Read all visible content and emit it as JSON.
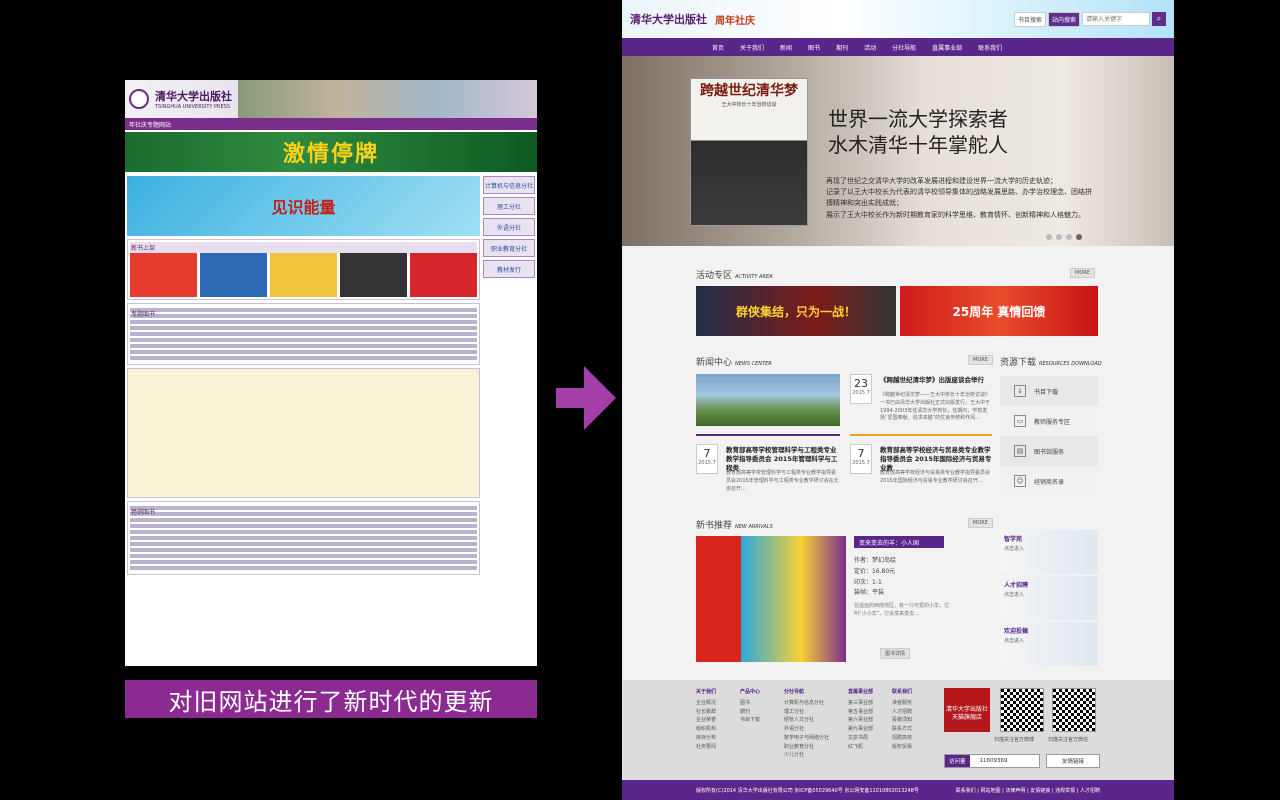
{
  "old_site": {
    "logo": "清华大学出版社",
    "logo_en": "TSINGHUA UNIVERSITY PRESS",
    "anniversary_strip": "年社庆专题网站",
    "banner_text": "激情停牌",
    "ad_text": "见识能量",
    "side_links": [
      "计算机与信息分社",
      "理工分社",
      "外语分社",
      "职业教育分社",
      "教材发行"
    ],
    "block_titles": [
      "新书上架",
      "专题图书",
      "畅销图书"
    ]
  },
  "caption": "对旧网站进行了新时代的更新",
  "arrow_color": "#a43ea8",
  "new_site": {
    "brand": "清华大学出版社",
    "anniversary": "周年社庆",
    "search": {
      "option1": "书目搜索",
      "option2": "站内搜索",
      "placeholder": "请输入关键字"
    },
    "nav": [
      "首页",
      "关于我们",
      "新闻",
      "图书",
      "期刊",
      "活动",
      "分社导航",
      "直属事业部",
      "联系我们"
    ],
    "hero": {
      "book_title": "跨越世纪清华梦",
      "book_subtitle": "王大中校长十年治校访谈",
      "headline1": "世界一流大学探索者",
      "headline2": "水木清华十年掌舵人",
      "summary1": "再现了世纪之交清华大学的改革发展进程和建设世界一流大学的历史轨迹；",
      "summary2": "记录了以王大中校长为代表的清华校领导集体的战略发展思路、办学治校理念、团结拼搏精神和突出实践成就；",
      "summary3": "展示了王大中校长作为新时期教育家的科学思维、教育情怀、创新精神和人格魅力。"
    },
    "activity": {
      "title": "活动专区",
      "title_en": "ACTIVITY AREA",
      "more": "MORE",
      "banner1": "群侠集结，只为一战！",
      "banner2": "25周年 真情回馈"
    },
    "news": {
      "title": "新闻中心",
      "title_en": "NEWS CENTER",
      "more": "MORE",
      "items": [
        {
          "day": "23",
          "ym": "2015.7",
          "title": "《跨越世纪清华梦》出版座谈会举行",
          "text": "《跨越世纪清华梦——王大中校长十年治校访谈》一书已由清华大学出版社正式出版发行。王大中于1994-2003年任清华大学校长，任期内，学校发扬“爱国奉献、追求卓越”的优良传统和作风..."
        },
        {
          "day": "7",
          "ym": "2015.7",
          "title": "教育部高等学校管理科学与工程类专业教学指导委员会 2015年管理科学与工程类",
          "text": "教育部高等学校管理科学与工程类专业教学指导委员会2015年管理科学与工程类专业教学研讨会在北京召开..."
        },
        {
          "day": "7",
          "ym": "2015.7",
          "title": "教育部高等学校经济与贸易类专业教学指导委员会 2015年国际经济与贸易专业教",
          "text": "教育部高等学校经济与贸易类专业教学指导委员会2015年国际经济与贸易专业教学研讨会召开..."
        }
      ]
    },
    "resources": {
      "title": "资源下载",
      "title_en": "RESOURCES DOWNLOAD",
      "items": [
        "书目下载",
        "教师服务专区",
        "图书馆服务",
        "经销商名录"
      ]
    },
    "new_books": {
      "title": "新书推荐",
      "title_en": "NEW ARRIVALS",
      "more": "MORE",
      "tag": "变来变去的羊：小人国",
      "author": "作者：梦幻岛绘",
      "price": "定价：16.80元",
      "edition": "印次：1-1",
      "binding": "装帧：平装",
      "desc": "在遥远的西南地区，有一只可爱的小羊，它叫“小小羊”，它会变来变去...",
      "detail_button": "图书详情",
      "side": [
        {
          "title": "智学苑",
          "note": "点击进入"
        },
        {
          "title": "人才招聘",
          "note": "点击进入"
        },
        {
          "title": "欢迎投稿",
          "note": "点击进入"
        }
      ]
    },
    "footer": {
      "cols": [
        {
          "title": "关于我们",
          "items": [
            "企业概况",
            "社长致辞",
            "企业荣誉",
            "组织机构",
            "库存分布",
            "社务要闻"
          ]
        },
        {
          "title": "产品中心",
          "items": [
            "图书",
            "期刊",
            "书目下载"
          ]
        },
        {
          "title": "分社导航",
          "items": [
            "计算机与信息分社",
            "理工分社",
            "经管人文分社",
            "外语分社",
            "数学电子与网络分社",
            "职业教育分社",
            "少儿分社"
          ]
        },
        {
          "title": "直属事业部",
          "items": [
            "第三事业部",
            "第五事业部",
            "第六事业部",
            "第九事业部",
            "文泉书局",
            "红飞机"
          ]
        },
        {
          "title": "联系我们",
          "items": [
            "读者服务",
            "人才招聘",
            "投稿须知",
            "联系方式",
            "招聘高校",
            "版权贸易"
          ]
        }
      ],
      "tmall": "清华大学出版社天猫旗舰店",
      "qr1_caption": "扫描关注官方微博",
      "qr2_caption": "扫描关注官方微信",
      "visits_label": "访问量",
      "visits": "11609369",
      "friend_links": "友情链接",
      "copyright": "版权所有(C)2014 清华大学出版社有限公司 京ICP备05029640号 京公网安备11010802013248号",
      "links": "联系我们 | 网站地图 | 法律声明 | 友情链接 | 违规举报 | 人才招聘"
    }
  }
}
